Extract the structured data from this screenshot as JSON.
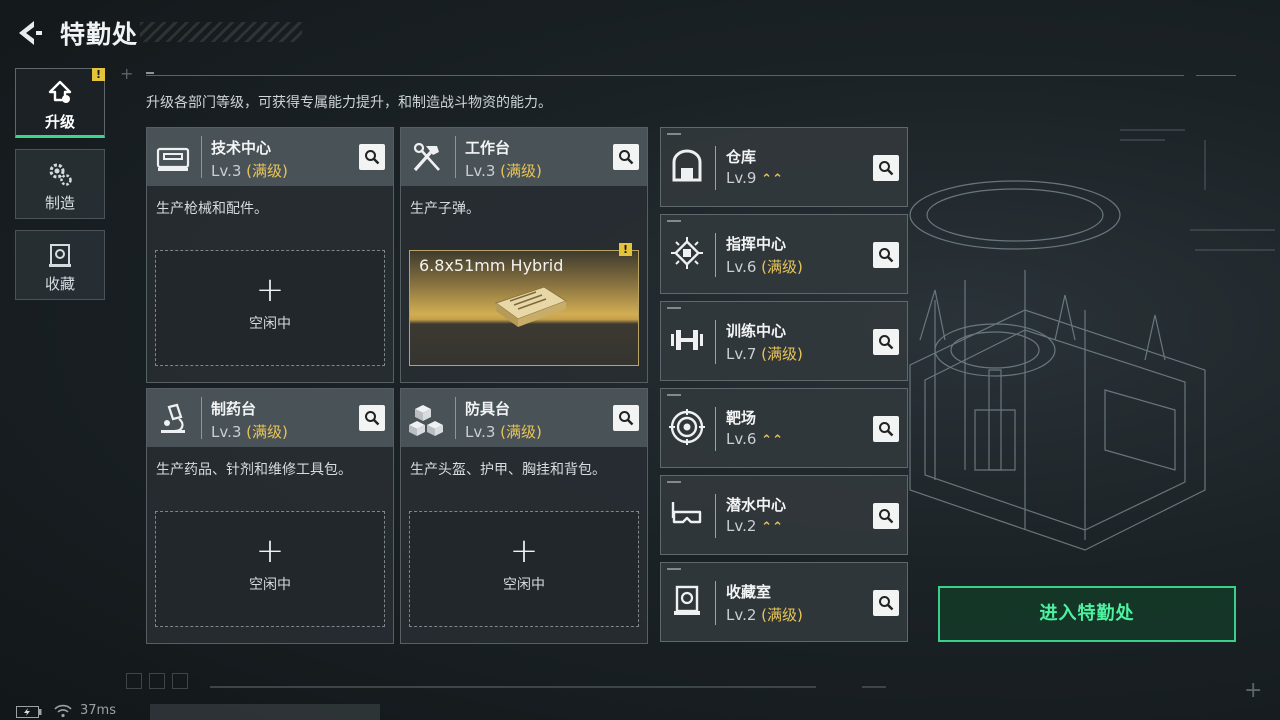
{
  "header": {
    "title": "特勤处",
    "back_icon": "back-arrow-icon"
  },
  "intro": "升级各部门等级，可获得专属能力提升，和制造战斗物资的能力。",
  "tabs": [
    {
      "label": "升级",
      "icon": "upgrade-icon",
      "active": true,
      "alert": "!"
    },
    {
      "label": "制造",
      "icon": "gears-icon",
      "active": false
    },
    {
      "label": "收藏",
      "icon": "collection-icon",
      "active": false
    }
  ],
  "cards": [
    {
      "name": "技术中心",
      "level": "Lv.3",
      "max": "(满级)",
      "desc": "生产枪械和配件。",
      "slot_plus": "+",
      "slot_label": "空闲中"
    },
    {
      "name": "工作台",
      "level": "Lv.3",
      "max": "(满级)",
      "desc": "生产子弹。",
      "ammo_name": "6.8x51mm Hybrid",
      "ammo_alert": "!"
    },
    {
      "name": "制药台",
      "level": "Lv.3",
      "max": "(满级)",
      "desc": "生产药品、针剂和维修工具包。",
      "slot_plus": "+",
      "slot_label": "空闲中"
    },
    {
      "name": "防具台",
      "level": "Lv.3",
      "max": "(满级)",
      "desc": "生产头盔、护甲、胸挂和背包。",
      "slot_plus": "+",
      "slot_label": "空闲中"
    }
  ],
  "facilities": [
    {
      "name": "仓库",
      "level": "Lv.9",
      "max": "",
      "upgrade": "⌃⌃"
    },
    {
      "name": "指挥中心",
      "level": "Lv.6",
      "max": "(满级)",
      "upgrade": ""
    },
    {
      "name": "训练中心",
      "level": "Lv.7",
      "max": "(满级)",
      "upgrade": ""
    },
    {
      "name": "靶场",
      "level": "Lv.6",
      "max": "",
      "upgrade": "⌃⌃"
    },
    {
      "name": "潜水中心",
      "level": "Lv.2",
      "max": "",
      "upgrade": "⌃⌃"
    },
    {
      "name": "收藏室",
      "level": "Lv.2",
      "max": "(满级)",
      "upgrade": ""
    }
  ],
  "enter_button": "进入特勤处",
  "status": {
    "ping": "37ms",
    "battery_icon": "battery-icon",
    "wifi_icon": "wifi-icon"
  },
  "colors": {
    "accent_green": "#3bd08a",
    "gold": "#e8c458",
    "alert": "#e4c43a"
  }
}
